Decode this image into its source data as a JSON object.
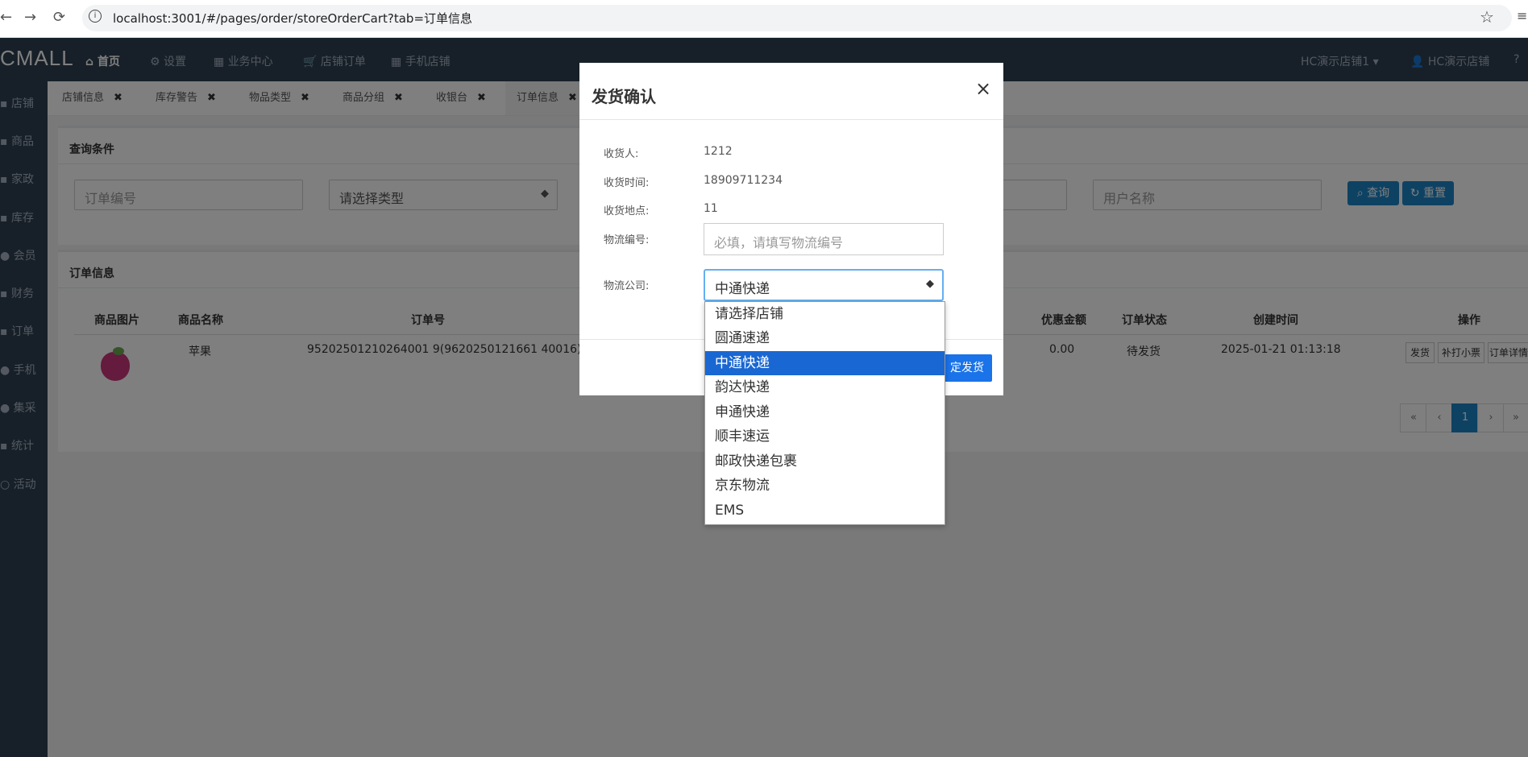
{
  "browser": {
    "url": "localhost:3001/#/pages/order/storeOrderCart?tab=订单信息"
  },
  "nav": {
    "logo": "CMALL",
    "items": [
      "首页",
      "设置",
      "业务中心",
      "店铺订单",
      "手机店铺"
    ],
    "right_items": [
      "HC演示店铺1",
      "HC演示店铺"
    ]
  },
  "sidebar": {
    "items": [
      "店铺",
      "商品",
      "家政",
      "库存",
      "会员",
      "财务",
      "订单",
      "手机",
      "集采",
      "统计",
      "活动"
    ]
  },
  "tabs": [
    "店铺信息",
    "库存警告",
    "物品类型",
    "商品分组",
    "收银台",
    "订单信息"
  ],
  "query": {
    "title": "查询条件",
    "order_no_placeholder": "订单编号",
    "type_select": "请选择类型",
    "user_placeholder": "用户名称",
    "search_btn": "查询",
    "reset_btn": "重置"
  },
  "orders": {
    "title": "订单信息",
    "columns": [
      "商品图片",
      "商品名称",
      "订单号",
      "优惠金额",
      "订单状态",
      "创建时间",
      "操作"
    ],
    "rows": [
      {
        "name": "苹果",
        "order_no": "95202501210264001 9(9620250121661 40016)",
        "discount": "0.00",
        "status": "待发货",
        "created": "2025-01-21 01:13:18"
      }
    ],
    "row_actions": [
      "发货",
      "补打小票",
      "订单详情"
    ],
    "pagination": [
      "«",
      "‹",
      "1",
      "›",
      "»"
    ]
  },
  "modal": {
    "title": "发货确认",
    "close": "×",
    "fields": [
      {
        "label": "收货人:",
        "value": "1212"
      },
      {
        "label": "收货时间:",
        "value": "18909711234"
      },
      {
        "label": "收货地点:",
        "value": "11"
      }
    ],
    "tracking_label": "物流编号:",
    "tracking_placeholder": "必填，请填写物流编号",
    "company_label": "物流公司:",
    "company_selected": "中通快递",
    "confirm_btn": "定发货"
  },
  "dropdown_options": [
    "请选择店铺",
    "圆通速递",
    "中通快递",
    "韵达快递",
    "申通快递",
    "顺丰速运",
    "邮政快递包裹",
    "京东物流",
    "EMS"
  ]
}
